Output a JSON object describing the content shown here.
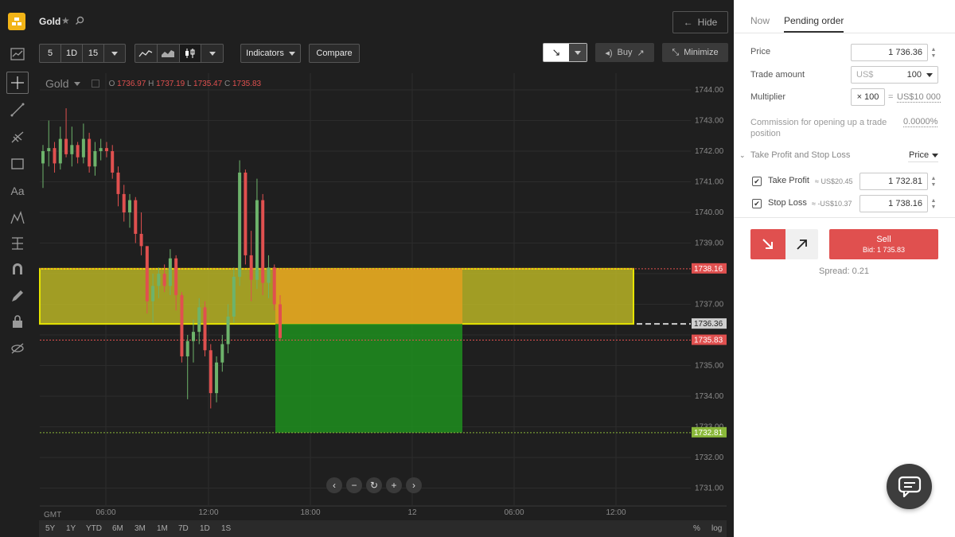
{
  "asset": {
    "name": "Gold"
  },
  "topbar": {
    "hide_label": "Hide"
  },
  "toolbar": {
    "timeframes": [
      "5",
      "1D",
      "15"
    ],
    "indicators_label": "Indicators",
    "compare_label": "Compare",
    "buy_label": "Buy",
    "minimize_label": "Minimize"
  },
  "legend": {
    "symbol": "Gold",
    "open_label": "O",
    "open": "1736.97",
    "high_label": "H",
    "high": "1737.19",
    "low_label": "L",
    "low": "1735.47",
    "close_label": "C",
    "close": "1735.83"
  },
  "price_axis": {
    "ticks": [
      "1744.00",
      "1743.00",
      "1742.00",
      "1741.00",
      "1740.00",
      "1739.00",
      "1737.00",
      "1735.00",
      "1734.00",
      "1733.00",
      "1732.00",
      "1731.00"
    ],
    "tags": {
      "stop_loss": "1738.16",
      "pending": "1736.36",
      "bid": "1735.83",
      "take_profit": "1732.81"
    }
  },
  "time_axis": {
    "gmt_label": "GMT",
    "ticks": [
      "06:00",
      "12:00",
      "18:00",
      "12",
      "06:00",
      "12:00"
    ]
  },
  "range_bar": {
    "ranges": [
      "5Y",
      "1Y",
      "YTD",
      "6M",
      "3M",
      "1M",
      "7D",
      "1D",
      "1S"
    ],
    "percent_label": "%",
    "log_label": "log"
  },
  "order_panel": {
    "tabs": [
      "Now",
      "Pending order"
    ],
    "price_label": "Price",
    "price_value": "1 736.36",
    "trade_amount_label": "Trade amount",
    "currency": "US$",
    "trade_amount_value": "100",
    "multiplier_label": "Multiplier",
    "multiplier_value": "× 100",
    "multiplier_eq": "=",
    "multiplier_result": "US$10 000",
    "commission_label": "Commission for opening up a trade position",
    "commission_value": "0.0000%",
    "tpsl_label": "Take Profit and Stop Loss",
    "tpsl_mode": "Price",
    "take_profit_label": "Take Profit",
    "take_profit_est": "≈ US$20.45",
    "take_profit_value": "1 732.81",
    "stop_loss_label": "Stop Loss",
    "stop_loss_est": "≈ -US$10.37",
    "stop_loss_value": "1 738.16",
    "sell_label": "Sell",
    "bid_label": "Bid: 1 735.83",
    "spread_label": "Spread: 0.21"
  },
  "colors": {
    "bg": "#1f1f1f",
    "bull": "#6db36b",
    "bear": "#e0504f",
    "zone_yellow": "#c6c226",
    "zone_orange": "#e0a020",
    "zone_green": "#1e8f1e",
    "accent_red": "#e0504f"
  },
  "chart_data": {
    "type": "candlestick",
    "symbol": "Gold",
    "ylim": [
      1730.5,
      1744.3
    ],
    "candles": [
      {
        "o": 1741.6,
        "h": 1742.2,
        "l": 1740.8,
        "c": 1742.0
      },
      {
        "o": 1742.0,
        "h": 1743.0,
        "l": 1741.5,
        "c": 1742.1
      },
      {
        "o": 1742.1,
        "h": 1742.3,
        "l": 1741.3,
        "c": 1741.6
      },
      {
        "o": 1741.6,
        "h": 1742.8,
        "l": 1741.4,
        "c": 1742.4
      },
      {
        "o": 1742.4,
        "h": 1743.4,
        "l": 1741.8,
        "c": 1741.9
      },
      {
        "o": 1741.9,
        "h": 1742.8,
        "l": 1741.5,
        "c": 1742.2
      },
      {
        "o": 1742.2,
        "h": 1742.3,
        "l": 1741.6,
        "c": 1741.8
      },
      {
        "o": 1741.8,
        "h": 1742.9,
        "l": 1741.6,
        "c": 1742.4
      },
      {
        "o": 1742.4,
        "h": 1742.6,
        "l": 1741.3,
        "c": 1741.5
      },
      {
        "o": 1741.5,
        "h": 1742.3,
        "l": 1741.2,
        "c": 1742.0
      },
      {
        "o": 1742.0,
        "h": 1742.4,
        "l": 1741.7,
        "c": 1742.1
      },
      {
        "o": 1742.1,
        "h": 1742.3,
        "l": 1741.8,
        "c": 1742.0
      },
      {
        "o": 1742.0,
        "h": 1742.2,
        "l": 1741.1,
        "c": 1741.3
      },
      {
        "o": 1741.3,
        "h": 1741.5,
        "l": 1740.2,
        "c": 1740.6
      },
      {
        "o": 1740.6,
        "h": 1740.9,
        "l": 1739.7,
        "c": 1740.0
      },
      {
        "o": 1740.0,
        "h": 1740.6,
        "l": 1739.5,
        "c": 1740.4
      },
      {
        "o": 1740.4,
        "h": 1740.5,
        "l": 1739.0,
        "c": 1739.3
      },
      {
        "o": 1739.3,
        "h": 1740.0,
        "l": 1738.6,
        "c": 1738.9
      },
      {
        "o": 1738.9,
        "h": 1738.9,
        "l": 1736.7,
        "c": 1737.1
      },
      {
        "o": 1737.1,
        "h": 1738.0,
        "l": 1736.4,
        "c": 1737.6
      },
      {
        "o": 1737.6,
        "h": 1738.2,
        "l": 1737.2,
        "c": 1738.0
      },
      {
        "o": 1738.0,
        "h": 1738.3,
        "l": 1737.4,
        "c": 1737.6
      },
      {
        "o": 1737.6,
        "h": 1738.8,
        "l": 1737.3,
        "c": 1738.5
      },
      {
        "o": 1738.5,
        "h": 1738.6,
        "l": 1736.8,
        "c": 1737.3
      },
      {
        "o": 1737.3,
        "h": 1737.4,
        "l": 1735.1,
        "c": 1735.3
      },
      {
        "o": 1735.3,
        "h": 1736.0,
        "l": 1733.9,
        "c": 1735.8
      },
      {
        "o": 1735.8,
        "h": 1736.5,
        "l": 1735.1,
        "c": 1736.1
      },
      {
        "o": 1736.1,
        "h": 1737.2,
        "l": 1735.7,
        "c": 1736.9
      },
      {
        "o": 1736.9,
        "h": 1737.1,
        "l": 1735.3,
        "c": 1735.5
      },
      {
        "o": 1735.5,
        "h": 1735.7,
        "l": 1733.6,
        "c": 1734.1
      },
      {
        "o": 1734.1,
        "h": 1735.3,
        "l": 1733.8,
        "c": 1735.1
      },
      {
        "o": 1735.1,
        "h": 1736.0,
        "l": 1734.8,
        "c": 1735.7
      },
      {
        "o": 1735.7,
        "h": 1737.0,
        "l": 1735.4,
        "c": 1736.6
      },
      {
        "o": 1736.6,
        "h": 1738.2,
        "l": 1736.4,
        "c": 1737.9
      },
      {
        "o": 1737.9,
        "h": 1741.7,
        "l": 1737.6,
        "c": 1741.3
      },
      {
        "o": 1741.3,
        "h": 1741.4,
        "l": 1738.3,
        "c": 1738.6
      },
      {
        "o": 1738.6,
        "h": 1739.4,
        "l": 1737.1,
        "c": 1737.8
      },
      {
        "o": 1737.8,
        "h": 1741.1,
        "l": 1737.5,
        "c": 1740.4
      },
      {
        "o": 1740.4,
        "h": 1740.6,
        "l": 1737.3,
        "c": 1737.7
      },
      {
        "o": 1737.7,
        "h": 1738.6,
        "l": 1737.2,
        "c": 1738.2
      },
      {
        "o": 1738.2,
        "h": 1738.3,
        "l": 1736.8,
        "c": 1737.0
      },
      {
        "o": 1737.0,
        "h": 1737.3,
        "l": 1735.8,
        "c": 1735.9
      }
    ],
    "levels": {
      "stop_loss": 1738.16,
      "pending_price": 1736.36,
      "bid": 1735.83,
      "take_profit": 1732.81
    }
  }
}
